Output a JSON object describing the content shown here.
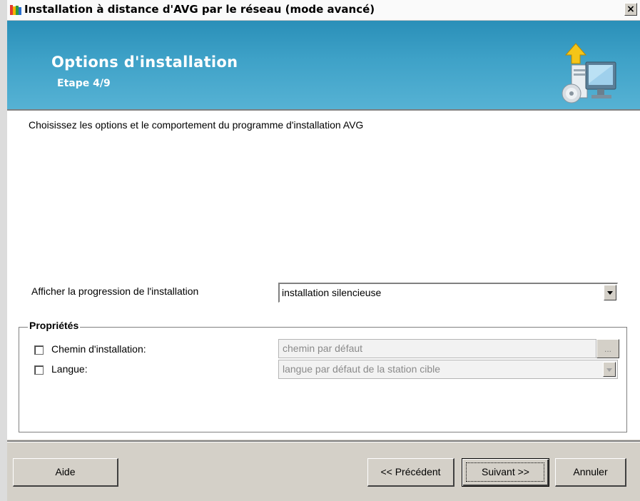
{
  "window": {
    "title": "Installation à distance d'AVG par le réseau (mode avancé)",
    "close_glyph": "×"
  },
  "header": {
    "title": "Options d'installation",
    "step": "Etape 4/9",
    "icon": "installer-computer-icon"
  },
  "content": {
    "intro": "Choisissez les options et le comportement du programme d'installation AVG",
    "progress_label": "Afficher la progression de l'installation",
    "progress_value": "installation silencieuse",
    "group_title": "Propriétés",
    "install_path": {
      "label": "Chemin d'installation:",
      "placeholder": "chemin par défaut",
      "browse_label": "...",
      "checked": false
    },
    "language": {
      "label": "Langue:",
      "value": "langue par défaut de la station cible",
      "checked": false
    }
  },
  "buttons": {
    "help": "Aide",
    "previous": "<< Précédent",
    "next": "Suivant >>",
    "cancel": "Annuler"
  },
  "colors": {
    "header_blue": "#3fa2c8",
    "dialog_gray": "#d4d0c8"
  }
}
